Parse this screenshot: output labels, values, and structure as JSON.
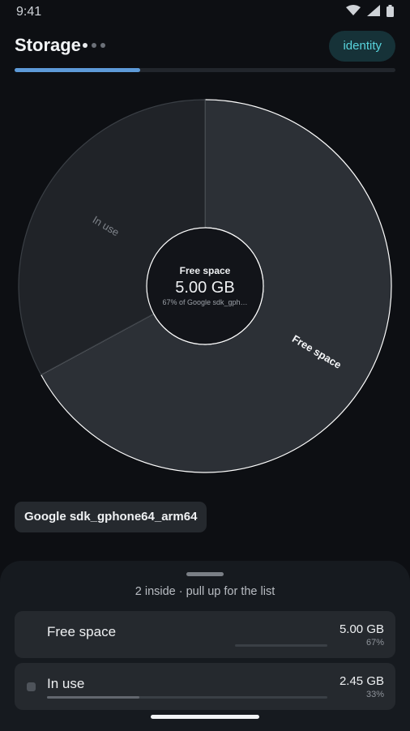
{
  "status": {
    "time": "9:41"
  },
  "header": {
    "title": "Storage",
    "identity_label": "identity",
    "progress": 0.33
  },
  "chart_data": {
    "type": "pie",
    "categories": [
      "Free space",
      "In use"
    ],
    "values": [
      5.0,
      2.45
    ],
    "center_title": "Free space",
    "center_value": "5.00 GB",
    "center_sub": "67% of Google sdk_gph…"
  },
  "device": {
    "name": "Google sdk_gphone64_arm64"
  },
  "sheet": {
    "hint": "2 inside · pull up for the list",
    "items": [
      {
        "label": "Free space",
        "size": "5.00 GB",
        "percent": "67%",
        "fraction": 0.67
      },
      {
        "label": "In use",
        "size": "2.45 GB",
        "percent": "33%",
        "fraction": 0.33
      }
    ]
  },
  "colors": {
    "accent": "#58d3dc",
    "progress": "#5d9ad8",
    "background": "#0d0f13"
  }
}
